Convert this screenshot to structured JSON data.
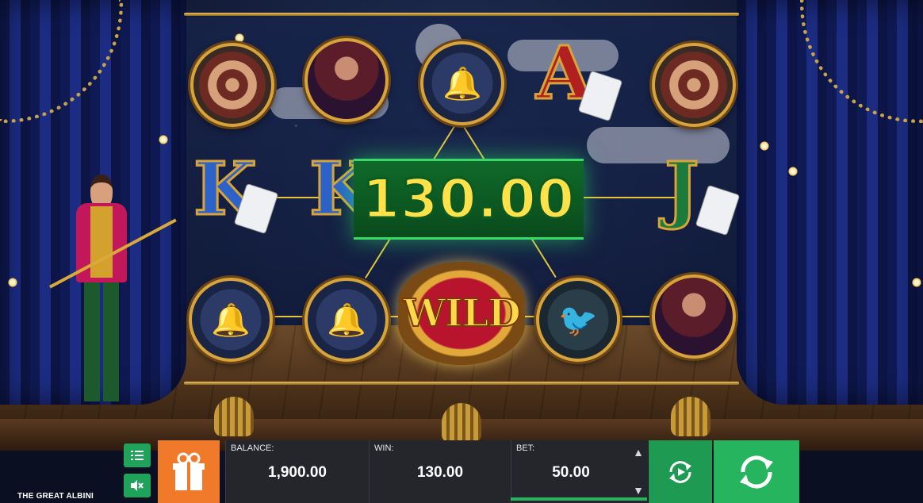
{
  "game": {
    "title": "THE GREAT ALBINI",
    "win_display": "130.00",
    "wild_label": "WILD"
  },
  "reels": {
    "letters": [
      {
        "name": "king-symbol-reel1",
        "text": "K",
        "color": "blue"
      },
      {
        "name": "king-symbol-reel2",
        "text": "K",
        "color": "blue"
      },
      {
        "name": "ace-symbol",
        "text": "A",
        "color": "red"
      },
      {
        "name": "jack-symbol",
        "text": "J",
        "color": "green"
      }
    ],
    "icons": [
      {
        "name": "target-icon"
      },
      {
        "name": "assistant-lady-icon"
      },
      {
        "name": "magic-bells-icon"
      },
      {
        "name": "canary-bird-icon"
      }
    ]
  },
  "hud": {
    "balance_label": "BALANCE:",
    "balance_value": "1,900.00",
    "win_label": "WIN:",
    "win_value": "130.00",
    "bet_label": "BET:",
    "bet_value": "50.00"
  },
  "colors": {
    "spin_green": "#27b45f",
    "gift_orange": "#f07a2a",
    "panel_dark": "#24262c",
    "win_yellow": "#ffe14a"
  }
}
